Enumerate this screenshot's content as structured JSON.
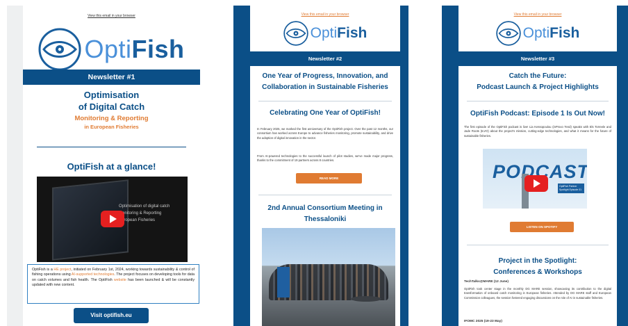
{
  "brand": {
    "opti": "Opti",
    "fish": "Fish",
    "accent": "#0b4f87",
    "highlight": "#e07b32"
  },
  "newsletter1": {
    "view_browser": "View this email in your browser",
    "bar": "Newsletter #1",
    "title_line1": "Optimisation",
    "title_line2": "of Digital Catch",
    "subtitle_line1": "Monitoring & Reporting",
    "subtitle_line2": "in European Fisheries",
    "glance": "OptiFish at a glance!",
    "video_caption_line1": "Optimisation of digital catch",
    "video_caption_line2": "Monitoring & Reporting",
    "video_caption_line3": "European Fisheries",
    "info": {
      "p1": "OptiFish is a ",
      "hl1": "HE project",
      "p2": ", initiated on February 1st, 2024, working towards sustainability & control of fishing operations using ",
      "hl2": "AI-supported technologies",
      "p3": ". The project focuses on developing tools for data on catch volumes and fish health. The OptiFish ",
      "hl3": "website",
      "p4": " has been launched & will be constantly updated with new content."
    },
    "visit_button": "Visit optifish.eu"
  },
  "newsletter2": {
    "view_browser": "View this email in your browser",
    "bar": "Newsletter #2",
    "title_line1": "One Year of Progress, Innovation, and",
    "title_line2": "Collaboration in Sustainable Fisheries",
    "section1_title": "Celebrating One Year of OptiFish!",
    "section1_p1": "In February 2025, we marked the first anniversary of the OptiFish project. Over the past 12 months, our consortium has worked across Europe to advance fisheries monitoring, promote sustainability, and drive the adoption of digital innovation in the sector.",
    "section1_p2": "From AI-powered technologies to the successful launch of pilot studies, we've made major progress, thanks to the commitment of 19 partners across 8 countries.",
    "read_more": "READ MORE",
    "section2_title_line1": "2nd Annual Consortium Meeting in",
    "section2_title_line2": "Thessaloniki"
  },
  "newsletter3": {
    "view_browser": "View this email in your browser",
    "bar": "Newsletter #3",
    "title_line1": "Catch the Future:",
    "title_line2": "Podcast Launch & Project Highlights",
    "section1_title": "OptiFish Podcast: Episode 1 Is Out Now!",
    "section1_p": "The first episode of the OptiFish podcast is live! Lia Kessopoulou (inProvo Tend) speaks with Els Torreele and Jade Roots (ILVO) about the project's mission, cutting-edge technologies, and what it means for the future of sustainable fisheries.",
    "podcast_word": "PODCAST",
    "podcast_side": "OptiFish Partner Spotlight Episode 01",
    "listen_button": "LISTEN ON SPOTIFY",
    "section2_title_line1": "Project in the Spotlight:",
    "section2_title_line2": "Conferences & Workshops",
    "event1_title": "TechTalks@MARE (12 June)",
    "event1_p": "OptiFish took center stage in the monthly DG MARE session, showcasing its contribution to the digital transformation of onboard catch monitoring in European fisheries. Attended by DG MARE staff and European Commission colleagues, the session fostered engaging discussions on the role of AI in sustainable fisheries.",
    "event2_title": "IFOMC 2025 (19-23 May)"
  }
}
